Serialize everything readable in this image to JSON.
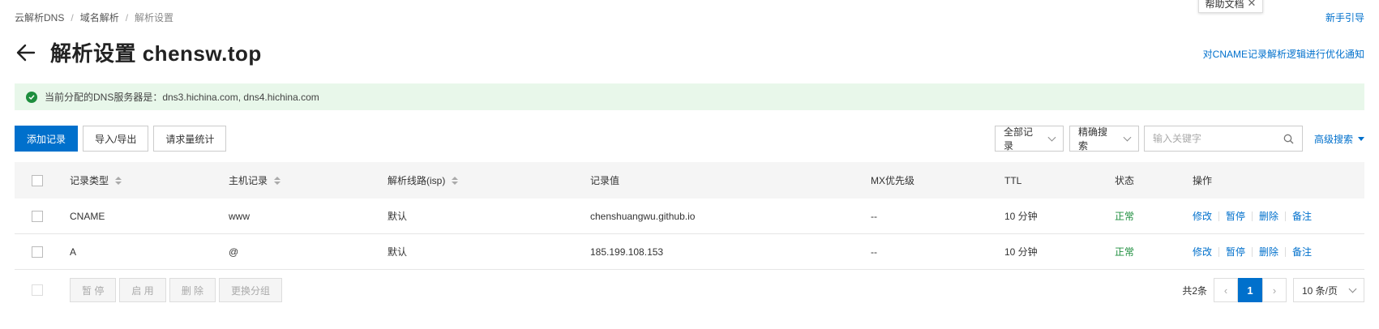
{
  "breadcrumb": [
    "云解析DNS",
    "域名解析",
    "解析设置"
  ],
  "help_tab": {
    "label": "帮助文档",
    "close": "✕"
  },
  "guide_link": "新手引导",
  "title": "解析设置 chensw.top",
  "notice_link": "对CNAME记录解析逻辑进行优化通知",
  "info_bar": "当前分配的DNS服务器是：dns3.hichina.com, dns4.hichina.com",
  "toolbar": {
    "add": "添加记录",
    "import_export": "导入/导出",
    "stats": "请求量统计"
  },
  "filters": {
    "all_records": "全部记录",
    "exact_search": "精确搜索",
    "search_placeholder": "输入关键字",
    "advanced": "高级搜索"
  },
  "table": {
    "headers": {
      "type": "记录类型",
      "host": "主机记录",
      "line": "解析线路(isp)",
      "value": "记录值",
      "mx": "MX优先级",
      "ttl": "TTL",
      "status": "状态",
      "ops": "操作"
    },
    "rows": [
      {
        "type": "CNAME",
        "host": "www",
        "line": "默认",
        "value": "chenshuangwu.github.io",
        "mx": "--",
        "ttl": "10 分钟",
        "status": "正常",
        "ops": [
          "修改",
          "暂停",
          "删除",
          "备注"
        ]
      },
      {
        "type": "A",
        "host": "@",
        "line": "默认",
        "value": "185.199.108.153",
        "mx": "--",
        "ttl": "10 分钟",
        "status": "正常",
        "ops": [
          "修改",
          "暂停",
          "删除",
          "备注"
        ]
      }
    ]
  },
  "bulk": {
    "pause": "暂 停",
    "enable": "启 用",
    "delete": "删 除",
    "change_group": "更换分组"
  },
  "pagination": {
    "total": "共2条",
    "prev": "‹",
    "current": "1",
    "next": "›",
    "page_size": "10 条/页"
  },
  "colors": {
    "primary": "#0070cc",
    "success": "#1e8e3e",
    "info_bg": "#e8f7ea"
  }
}
